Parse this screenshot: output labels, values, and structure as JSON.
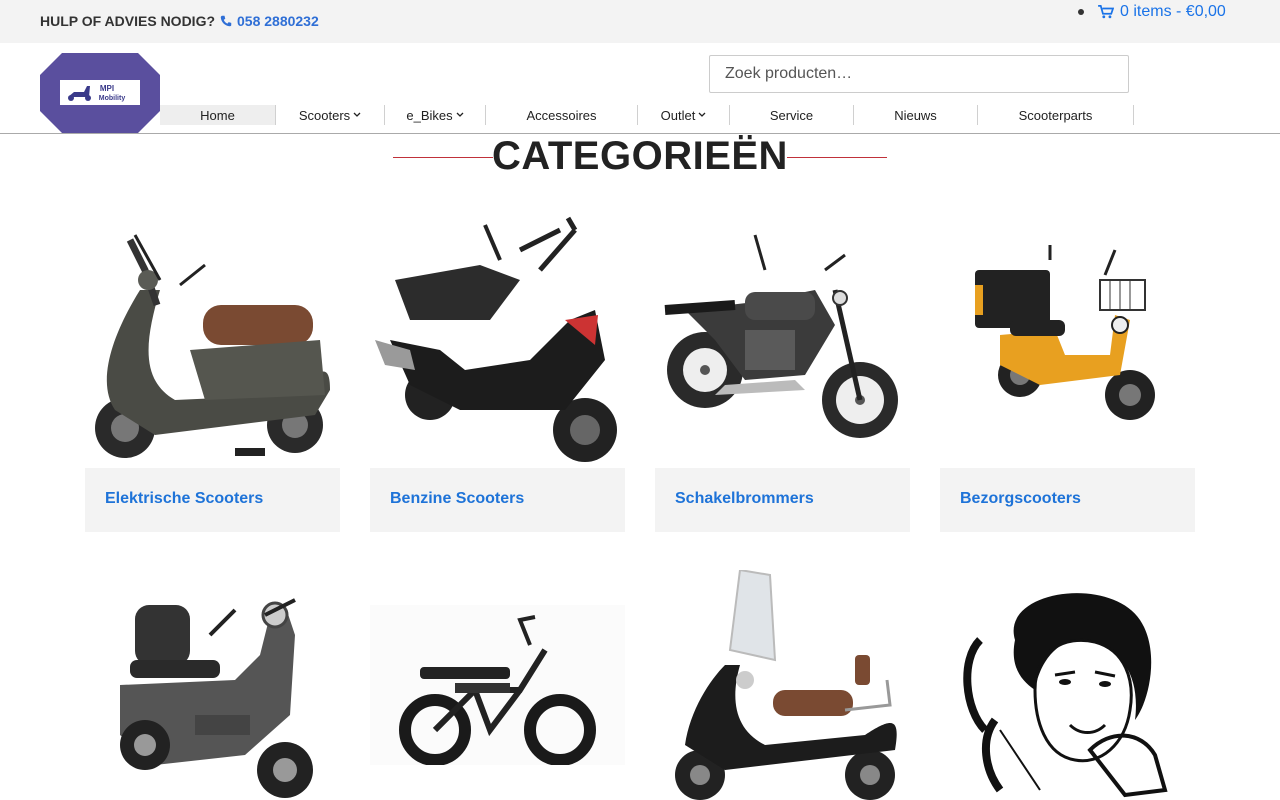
{
  "topbar": {
    "help_text": "HULP OF ADVIES NODIG?",
    "phone": "058 2880232",
    "cart_text": "0 items - €0,00"
  },
  "logo": {
    "text_line1": "MPI",
    "text_line2": "Mobility"
  },
  "search": {
    "placeholder": "Zoek producten…"
  },
  "nav": [
    {
      "label": "Home",
      "dropdown": false,
      "active": true
    },
    {
      "label": "Scooters",
      "dropdown": true
    },
    {
      "label": "e_Bikes",
      "dropdown": true
    },
    {
      "label": "Accessoires",
      "dropdown": false
    },
    {
      "label": "Outlet",
      "dropdown": true
    },
    {
      "label": "Service",
      "dropdown": false
    },
    {
      "label": "Nieuws",
      "dropdown": false
    },
    {
      "label": "Scooterparts",
      "dropdown": false
    }
  ],
  "heading": "CATEGORIEËN",
  "categories": [
    {
      "label": "Elektrische Scooters",
      "image": "electric-scooter-image"
    },
    {
      "label": "Benzine Scooters",
      "image": "petrol-scooter-image"
    },
    {
      "label": "Schakelbrommers",
      "image": "motorcycle-image"
    },
    {
      "label": "Bezorgscooters",
      "image": "delivery-scooter-image"
    },
    {
      "label": "",
      "image": "mobility-scooter-image"
    },
    {
      "label": "",
      "image": "fat-ebike-image"
    },
    {
      "label": "",
      "image": "retro-scooter-windshield-image"
    },
    {
      "label": "",
      "image": "retro-woman-phone-illustration"
    }
  ],
  "colors": {
    "accent": "#1e73d8",
    "topbar_bg": "#f3f3f3",
    "rule": "#c0313a",
    "logo": "#5a4f9e"
  }
}
